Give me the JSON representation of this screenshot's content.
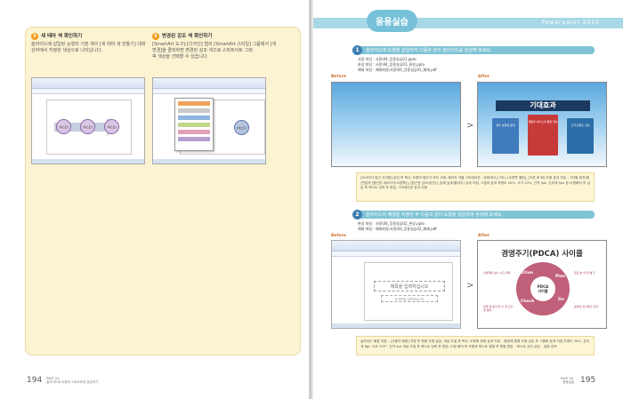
{
  "left_page": {
    "step5": {
      "num": "5",
      "title": "새 테마 색 확인하기",
      "desc_line1": "슬라이드에 삽입된 눈형의 기본 색이 [새 테마 색 만들기] 대화",
      "desc_line2": "상자에서 지정한 색상으로 나타납니다."
    },
    "step6": {
      "num": "6",
      "title": "변경된 강조 색 확인하기",
      "desc_line1": "[SmartArt 도구]-[디자인] 탭의 [SmartArt 스타일] 그룹에서 [색",
      "desc_line2": "변경]을 클릭하면 변경된 강조 색으로 스마트아트 그래",
      "desc_line3": "픽 색상을 선택할 수 있습니다."
    },
    "smartart_nodes": [
      "[텍스트]",
      "[텍스트]",
      "[텍스트]"
    ],
    "page_number": "194",
    "part_label": "PART 04.",
    "part_desc": "슬라이드와 도형의 스마트하게 삽입하기"
  },
  "right_page": {
    "header_title": "응용실습",
    "header_right": "Powerpoint 2010",
    "section1": {
      "num": "1",
      "title": "슬라이드에 도형을 삽입하여 다음과 같이 슬라이드를 완성해 보세요.",
      "files": [
        "사용 파일 : 사용\\04_응용실습01.pptx",
        "완성 파일 : 사용\\04_응용실습01_완성.pptx",
        "예제 파일 : 예제파일\\사용\\04_응용실습01_예제.pdf"
      ],
      "before_label": "Before",
      "after_label": "After",
      "banner_text": "기대효과",
      "books": [
        "업무 효율성 증대",
        "제품과 서비스의 품질 향상",
        "고객 만족도 향상"
      ],
      "note": "[오서리가 둥근 사각형] 삽입 후 복사, 도형의 채우기 모두 삭제, 페이지 색을 그라데이션 - 유화색이 [그리], [오른쪽 밸런], [오른 위 회] 도형 효과 지정 – 3차원 회전(원근법)의 [원근감 내리치기(오른쪽)], [원근감 강조(완전)], 입체 효과(콜라주) 효과 지정, 그림자 효과 투명도 50%, 크기 23%, 간격 5pt, 흐리게 5px 등 도형배치 후 삽입 후 텍스트 입력 후 편집, 그라데이션 효과 지정"
    },
    "section2": {
      "num": "2",
      "title": "슬라이드의 배경을 지정한 후 다음과 같이 도형을 삽입하여 완성해 보세요.",
      "files": [
        "완성 파일 : 사용\\04_응용실습02_완성.pptx",
        "예제 파일 : 예제파일\\사용\\04_응용실습02_예제.pdf"
      ],
      "before_label": "Before",
      "after_label": "After",
      "placeholder_title": "제목을 입력하십시오",
      "placeholder_sub": "부제목을 입력하십시오",
      "pdca_title": "경영주기(PDCA) 사이클",
      "pdca_center": "PDCA\n사이클",
      "pdca_words": [
        "Plan",
        "Do",
        "Check",
        "Action"
      ],
      "pdca_labels": [
        "사업계획 실시 시간 계획",
        "점검 분 석 및 평가",
        "효율성 실시방안 모색",
        "실행 및 분석 및 수 정 조건 및 결과"
      ],
      "note": "슬라이드 배경 지정 – [사용자 배경] 지정 후 원형 도형 삽입, 색상 조절 후 복사, 도형에 정제 효과 지정 – 원본에 원형 도형 삽입 후 그룹화 효과 지정 투명도 30%, 흐리게 8pt, 각도 330°, 간격 4pt 색상 조절 후 텍스트 입력 후 편집, 도형 배치 후 도형과 텍스트 정렬 후 원형 편집 – 텍스트 상자 삽입 – 설명 입력",
      "page_number": "195",
      "part_label": "PART 04.",
      "part_desc": "응용실습"
    }
  }
}
